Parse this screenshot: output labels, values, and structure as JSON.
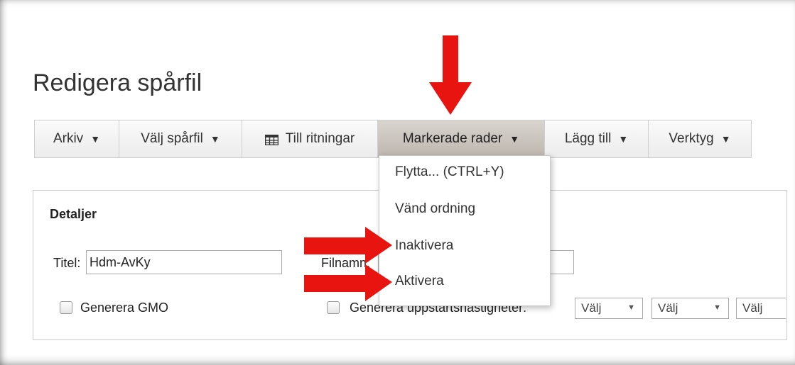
{
  "page": {
    "title": "Redigera spårfil"
  },
  "toolbar": {
    "items": [
      {
        "label": "Arkiv",
        "caret": "▼"
      },
      {
        "label": "Välj spårfil",
        "caret": "▼"
      },
      {
        "label": "Till ritningar",
        "icon": "table-grid-icon"
      },
      {
        "label": "Markerade rader",
        "caret": "▼",
        "active": true
      },
      {
        "label": "Lägg till",
        "caret": "▼"
      },
      {
        "label": "Verktyg",
        "caret": "▼"
      }
    ]
  },
  "dropdown": {
    "items": [
      {
        "label": "Flytta... (CTRL+Y)"
      },
      {
        "label": "Vänd ordning"
      },
      {
        "label": "Inaktivera"
      },
      {
        "label": "Aktivera"
      }
    ]
  },
  "details": {
    "heading": "Detaljer",
    "title_label": "Titel:",
    "title_value": "Hdm-AvKy",
    "filename_label": "Filnamn:",
    "filename_value": "",
    "gmo_label": "Generera GMO",
    "speeds_label": "Generera uppstartshastigheter:",
    "selects": [
      "Välj",
      "Välj",
      "Välj"
    ]
  },
  "colors": {
    "annotation_arrow": "#e8140f",
    "active_button": "#c4bdb5"
  }
}
